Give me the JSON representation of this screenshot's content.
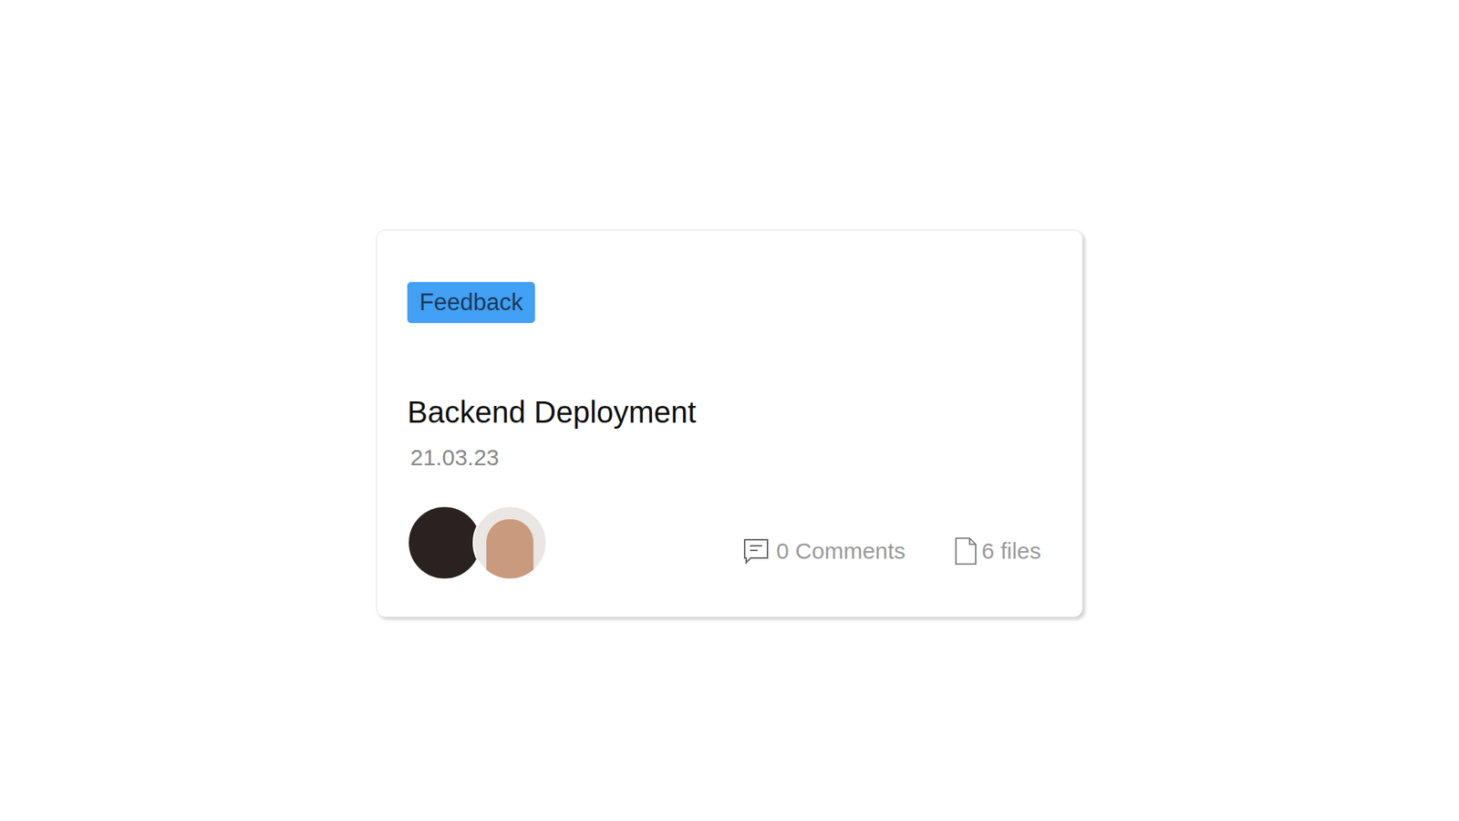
{
  "card": {
    "tag": "Feedback",
    "title": "Backend Deployment",
    "date": "21.03.23",
    "comments": "0 Comments",
    "files": "6 files"
  }
}
